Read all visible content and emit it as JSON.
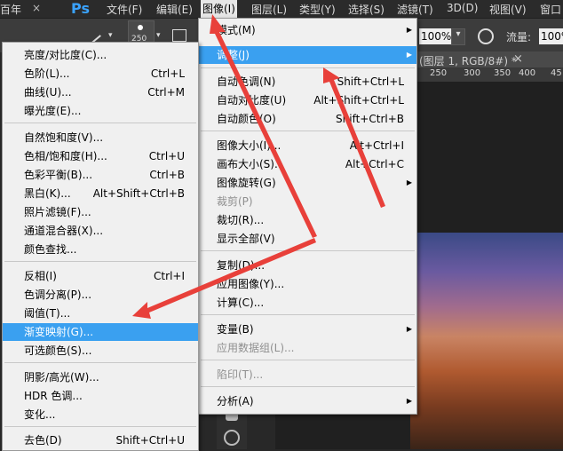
{
  "app": {
    "logo": "Ps"
  },
  "menubar": {
    "left_clip": "百年",
    "close_glyph": "×",
    "items": [
      "文件(F)",
      "编辑(E)",
      "图像(I)",
      "图层(L)",
      "类型(Y)",
      "选择(S)",
      "滤镜(T)",
      "3D(D)",
      "视图(V)",
      "窗口"
    ]
  },
  "options": {
    "brush_size": "250",
    "zoom_value": "100%",
    "flow_label": "流量:",
    "flow_value": "100%"
  },
  "document": {
    "tab_title": "(图层 1, RGB/8#) *",
    "tab_close": "×",
    "ruler_ticks": [
      "250",
      "300",
      "350",
      "400",
      "45"
    ]
  },
  "image_menu": [
    {
      "label": "模式(M)",
      "submenu": true
    },
    {
      "label": "调整(J)",
      "submenu": true,
      "highlighted": true
    },
    {
      "label": "自动色调(N)",
      "shortcut": "Shift+Ctrl+L"
    },
    {
      "label": "自动对比度(U)",
      "shortcut": "Alt+Shift+Ctrl+L"
    },
    {
      "label": "自动颜色(O)",
      "shortcut": "Shift+Ctrl+B"
    },
    {
      "label": "图像大小(I)...",
      "shortcut": "Alt+Ctrl+I"
    },
    {
      "label": "画布大小(S)...",
      "shortcut": "Alt+Ctrl+C"
    },
    {
      "label": "图像旋转(G)",
      "submenu": true
    },
    {
      "label": "裁剪(P)",
      "disabled": true
    },
    {
      "label": "裁切(R)..."
    },
    {
      "label": "显示全部(V)"
    },
    {
      "label": "复制(D)..."
    },
    {
      "label": "应用图像(Y)..."
    },
    {
      "label": "计算(C)..."
    },
    {
      "label": "变量(B)",
      "submenu": true
    },
    {
      "label": "应用数据组(L)...",
      "disabled": true
    },
    {
      "label": "陷印(T)...",
      "disabled": true
    },
    {
      "label": "分析(A)",
      "submenu": true
    }
  ],
  "adjust_menu": [
    {
      "label": "亮度/对比度(C)..."
    },
    {
      "label": "色阶(L)...",
      "shortcut": "Ctrl+L"
    },
    {
      "label": "曲线(U)...",
      "shortcut": "Ctrl+M"
    },
    {
      "label": "曝光度(E)..."
    },
    {
      "label": "自然饱和度(V)..."
    },
    {
      "label": "色相/饱和度(H)...",
      "shortcut": "Ctrl+U"
    },
    {
      "label": "色彩平衡(B)...",
      "shortcut": "Ctrl+B"
    },
    {
      "label": "黑白(K)...",
      "shortcut": "Alt+Shift+Ctrl+B"
    },
    {
      "label": "照片滤镜(F)..."
    },
    {
      "label": "通道混合器(X)..."
    },
    {
      "label": "颜色查找..."
    },
    {
      "label": "反相(I)",
      "shortcut": "Ctrl+I"
    },
    {
      "label": "色调分离(P)..."
    },
    {
      "label": "阈值(T)..."
    },
    {
      "label": "渐变映射(G)...",
      "highlighted": true
    },
    {
      "label": "可选颜色(S)..."
    },
    {
      "label": "阴影/高光(W)..."
    },
    {
      "label": "HDR 色调..."
    },
    {
      "label": "变化..."
    },
    {
      "label": "去色(D)",
      "shortcut": "Shift+Ctrl+U"
    }
  ],
  "colors": {
    "highlight": "#3aa0f0",
    "arrow": "#e8403a",
    "ps_blue": "#3aa3ff"
  }
}
